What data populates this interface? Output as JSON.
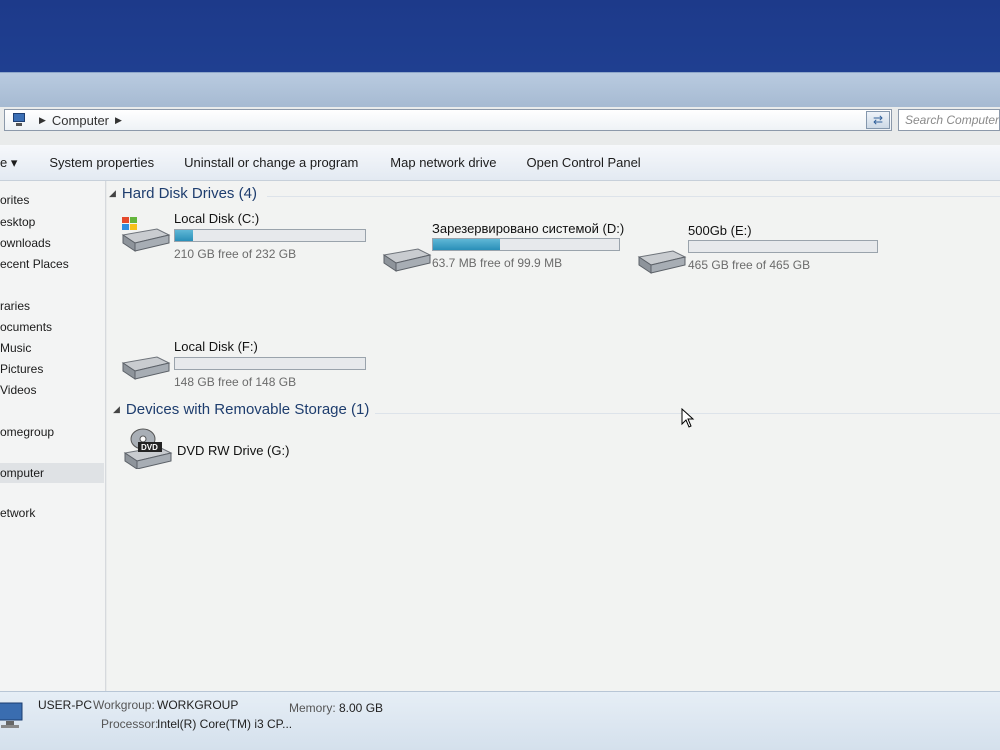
{
  "address": {
    "path_label": "Computer"
  },
  "search": {
    "placeholder": "Search Computer"
  },
  "toolbar": {
    "organize": "e ▾",
    "items": [
      "System properties",
      "Uninstall or change a program",
      "Map network drive",
      "Open Control Panel"
    ]
  },
  "nav": {
    "items": [
      "orites",
      "esktop",
      "ownloads",
      "ecent Places",
      "raries",
      "ocuments",
      "Music",
      "Pictures",
      "Videos",
      "omegroup",
      "omputer",
      "etwork"
    ]
  },
  "groups": {
    "hard_disks": "Hard Disk Drives (4)",
    "removable": "Devices with Removable Storage (1)"
  },
  "drives": [
    {
      "name": "Local Disk (C:)",
      "free_text": "210 GB free of 232 GB",
      "used_fraction": 0.095,
      "icon": "windows-drive-icon"
    },
    {
      "name": "Зарезервировано системой (D:)",
      "free_text": "63.7 MB free of 99.9 MB",
      "used_fraction": 0.36,
      "icon": "hard-drive-icon"
    },
    {
      "name": "500Gb (E:)",
      "free_text": "465 GB free of 465 GB",
      "used_fraction": 0.0,
      "icon": "hard-drive-icon"
    },
    {
      "name": "Local Disk (F:)",
      "free_text": "148 GB free of 148 GB",
      "used_fraction": 0.0,
      "icon": "hard-drive-icon"
    }
  ],
  "removable": [
    {
      "name": "DVD RW Drive (G:)",
      "icon": "dvd-drive-icon",
      "badge": "DVD"
    }
  ],
  "details": {
    "computer_name": "USER-PC",
    "workgroup_label": "Workgroup:",
    "workgroup_value": "WORKGROUP",
    "memory_label": "Memory:",
    "memory_value": "8.00 GB",
    "processor_label": "Processor:",
    "processor_value": "Intel(R) Core(TM) i3 CP..."
  },
  "colors": {
    "bar_fill": "#2a8fb8",
    "header_text": "#1e3d6e",
    "desktop": "#2752a8"
  }
}
